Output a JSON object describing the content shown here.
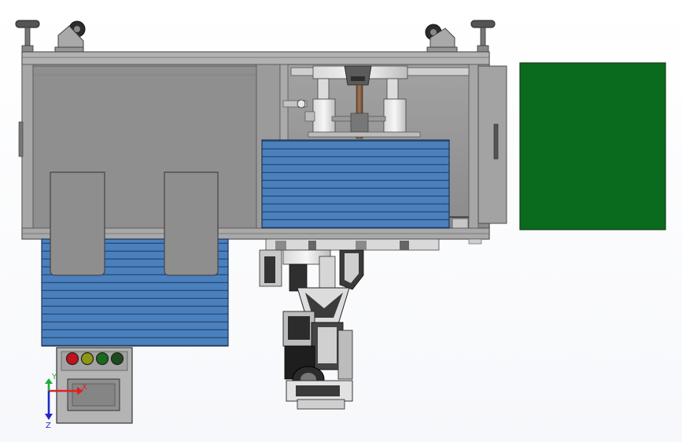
{
  "view": {
    "background": "#ffffff",
    "frame_color": "#8e8e8e",
    "frame_dark": "#555555",
    "tray_blue": "#4a80bd",
    "tray_line": "#243f66",
    "green_panel": "#0a6a1d",
    "signal_lights": [
      {
        "name": "red-light",
        "color": "#c3121b"
      },
      {
        "name": "yellow-light",
        "color": "#8d9713"
      },
      {
        "name": "green-light",
        "color": "#1a6a1d"
      },
      {
        "name": "dark-green-light",
        "color": "#1e4a1e"
      }
    ]
  },
  "triad": {
    "x_label": "X",
    "y_label": "Y",
    "z_label": "Z",
    "x_color": "#e0201d",
    "y_color": "#1fae3a",
    "z_color": "#2226cc"
  }
}
